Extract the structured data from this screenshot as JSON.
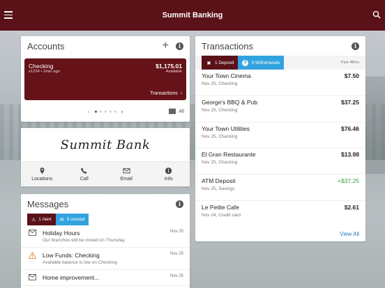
{
  "header": {
    "title": "Summit Banking"
  },
  "accounts": {
    "title": "Accounts",
    "tile": {
      "name": "Checking",
      "detail": "x1234 • 2min ago",
      "balance": "$1,175.01",
      "balance_label": "Available",
      "transactions_link": "Transactions"
    },
    "all_label": "All"
  },
  "brand": {
    "logo_text": "Summit Bank",
    "actions": [
      {
        "label": "Locations",
        "icon": "map-pin-icon"
      },
      {
        "label": "Call",
        "icon": "phone-icon"
      },
      {
        "label": "Email",
        "icon": "envelope-icon"
      },
      {
        "label": "Info",
        "icon": "info-icon"
      }
    ]
  },
  "messages": {
    "title": "Messages",
    "tabs": {
      "alerts": "1 Alert",
      "unread": "5 unread"
    },
    "items": [
      {
        "title": "Holiday Hours",
        "preview": "Our branches will be closed on Thursday.",
        "date": "Nov 25",
        "icon": "envelope-icon"
      },
      {
        "title": "Low Funds: Checking",
        "preview": "Available balance is low on Checking",
        "date": "Nov 25",
        "icon": "warning-icon"
      },
      {
        "title": "Home improvement...",
        "preview": "",
        "date": "Nov 25",
        "icon": "envelope-icon"
      }
    ]
  },
  "transactions": {
    "title": "Transactions",
    "tabs": {
      "deposits": "1 Deposit",
      "withdrawals": "9 Withdrawals"
    },
    "range": "Past 48hrs",
    "items": [
      {
        "name": "Your Town Cinema",
        "date": "Nov 25, Checking",
        "amount": "$7.50"
      },
      {
        "name": "George's BBQ & Pub",
        "date": "Nov 25, Checking",
        "amount": "$37.25"
      },
      {
        "name": "Your Town Utilities",
        "date": "Nov 25, Checking",
        "amount": "$76.46"
      },
      {
        "name": "El Gran Restaurante",
        "date": "Nov 25, Checking",
        "amount": "$13.98"
      },
      {
        "name": "ATM Deposit",
        "date": "Nov 25, Savings",
        "amount": "+$37.25"
      },
      {
        "name": "Le Petite Cafe",
        "date": "Nov 24, Credit card",
        "amount": "$2.61"
      }
    ],
    "view_all": "View All"
  },
  "colors": {
    "brand": "#5a1218",
    "accent": "#33a3e0",
    "positive": "#3a9a3a",
    "link": "#2a7ab8"
  }
}
